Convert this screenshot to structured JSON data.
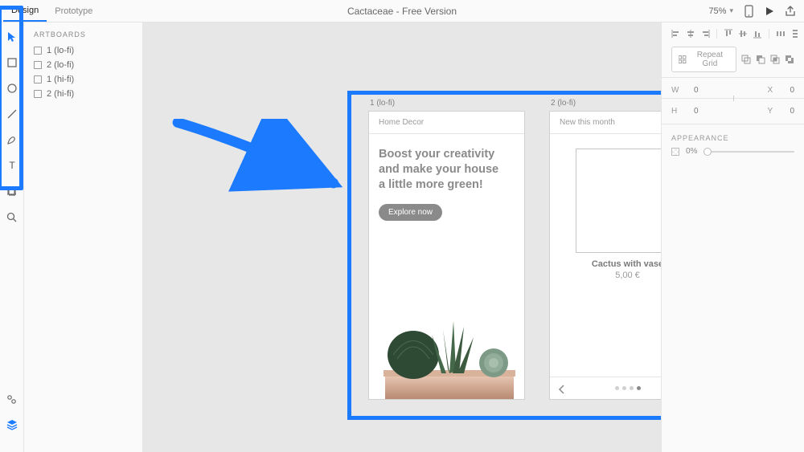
{
  "topbar": {
    "tabs": [
      "Design",
      "Prototype"
    ],
    "active_tab": 0,
    "title": "Cactaceae - Free Version",
    "zoom": "75%"
  },
  "artboards_panel": {
    "header": "ARTBOARDS",
    "items": [
      "1 (lo-fi)",
      "2 (lo-fi)",
      "1 (hi-fi)",
      "2 (hi-fi)"
    ]
  },
  "canvas": {
    "artboards": [
      {
        "label": "1 (lo-fi)",
        "header": "Home Decor",
        "hero_title": "Boost your creativity\nand make your house\na little more green!",
        "cta": "Explore now"
      },
      {
        "label": "2 (lo-fi)",
        "header": "New this month",
        "product_title": "Cactus with vase",
        "product_price": "5,00 €"
      }
    ]
  },
  "inspector": {
    "repeat_grid": "Repeat Grid",
    "w_label": "W",
    "w_value": "0",
    "x_label": "X",
    "x_value": "0",
    "h_label": "H",
    "h_value": "0",
    "y_label": "Y",
    "y_value": "0",
    "appearance_header": "APPEARANCE",
    "opacity": "0%"
  }
}
